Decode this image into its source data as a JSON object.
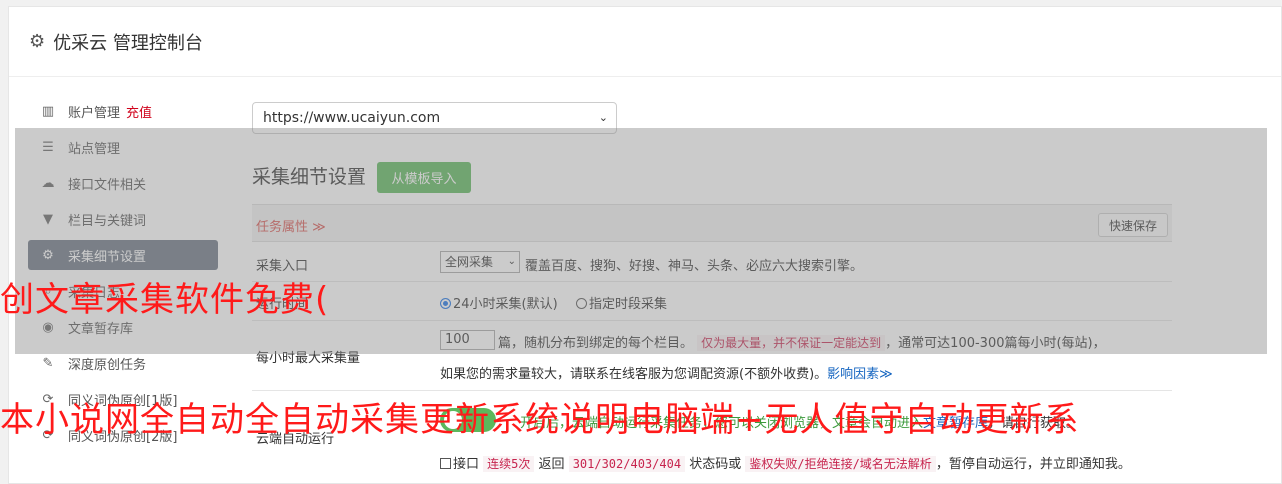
{
  "header": {
    "icon": "gear-icon",
    "title": "优采云 管理控制台"
  },
  "sidebar": {
    "items": [
      {
        "icon": "bar-chart-icon",
        "label": "账户管理",
        "extra": "充值"
      },
      {
        "icon": "server-icon",
        "label": "站点管理",
        "extra": ""
      },
      {
        "icon": "cloud-upload-icon",
        "label": "接口文件相关",
        "extra": ""
      },
      {
        "icon": "filter-icon",
        "label": "栏目与关键词",
        "extra": ""
      },
      {
        "icon": "cogs-icon",
        "label": "采集细节设置",
        "extra": ""
      },
      {
        "icon": "search-icon",
        "label": "采集日志",
        "extra": ""
      },
      {
        "icon": "database-icon",
        "label": "文章暂存库",
        "extra": ""
      },
      {
        "icon": "edit-icon",
        "label": "深度原创任务",
        "extra": ""
      },
      {
        "icon": "refresh-icon",
        "label": "同义词伪原创[1版]",
        "extra": ""
      },
      {
        "icon": "refresh-icon",
        "label": "同义词伪原创[2版]",
        "extra": ""
      }
    ]
  },
  "site_select": {
    "value": "https://www.ucaiyun.com"
  },
  "section": {
    "title": "采集细节设置",
    "template_button": "从模板导入"
  },
  "task_bar": {
    "attr_label": "任务属性 ≫",
    "quick_save": "快速保存"
  },
  "rows": {
    "entry": {
      "label": "采集入口",
      "select_value": "全网采集",
      "desc": "覆盖百度、搜狗、好搜、神马、头条、必应六大搜索引擎。"
    },
    "run_time": {
      "label": "运行时间",
      "option1": "24小时采集(默认)",
      "option2": "指定时段采集"
    },
    "max_per_hour": {
      "label": "每小时最大采集量",
      "value": "100",
      "text1": "篇，随机分布到绑定的每个栏目。",
      "highlight": "仅为最大量，并不保证一定能达到",
      "text2": "，通常可达100-300篇每小时(每站)，",
      "text3": "如果您的需求量较大，请联系在线客服为您调配资源(不额外收费)。",
      "link": "影响因素≫"
    },
    "cloud_run": {
      "label": "云端自动运行",
      "toggle_text": "开启后，云端自动运行采集任务，您可以关闭浏览器，文章会自动进入",
      "link": "文章暂存库",
      "tail": "，请自行获取。",
      "check_label": "接口",
      "code1": "连续5次",
      "text_ret": "返回",
      "code2": "301/302/403/404",
      "text_status": "状态码或",
      "code3": "鉴权失败/拒绝连接/域名无法解析",
      "text_end": "，暂停自动运行，并立即通知我。"
    }
  },
  "watermarks": {
    "line1": "创文章采集软件免费(",
    "line2": "本小说网全自动全自动采集更新系统说明电脑端+无人值守自动更新系"
  }
}
